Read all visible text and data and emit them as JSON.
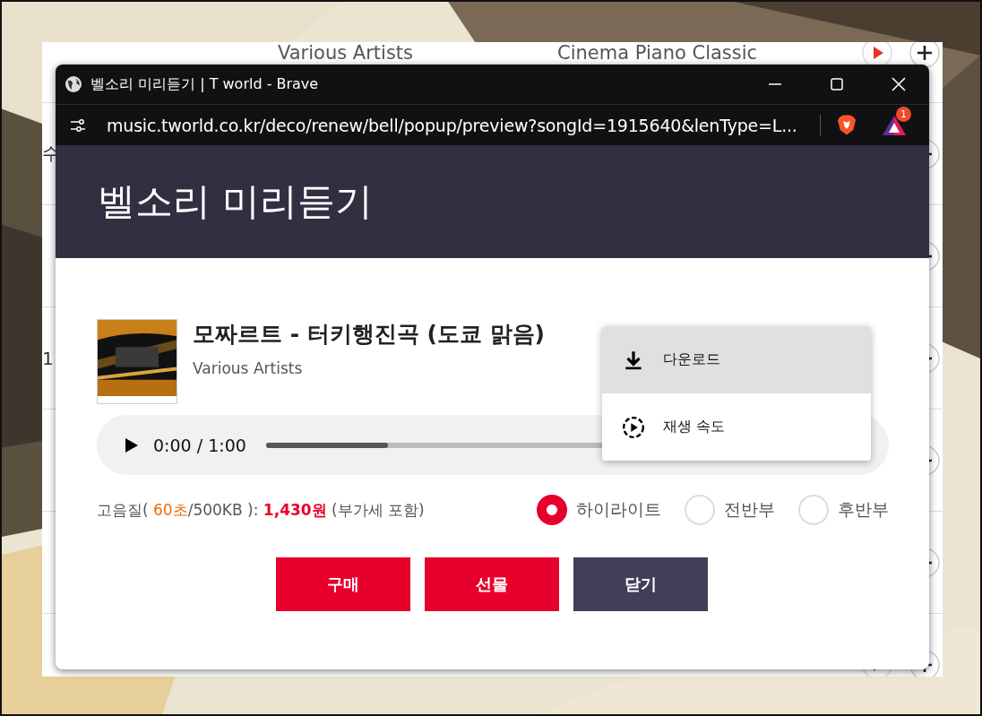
{
  "background_page": {
    "rows": [
      {
        "artist": "Various Artists",
        "album": "Cinema Piano Classic"
      },
      {
        "column_1": "수"
      },
      {},
      {
        "column_1": "1"
      },
      {},
      {},
      {}
    ]
  },
  "window": {
    "title": "벨소리 미리듣기 | T world - Brave",
    "url": "music.tworld.co.kr/deco/renew/bell/popup/preview?songId=1915640&lenType=L...",
    "extension_badge": "1"
  },
  "header": {
    "title": "벨소리 미리듣기"
  },
  "song": {
    "title": "모짜르트 - 터키행진곡 (도쿄 맑음)",
    "artist": "Various Artists"
  },
  "player": {
    "time": "0:00 / 1:00",
    "level": 0.21
  },
  "menu": {
    "items": [
      {
        "label": "다운로드",
        "kind": "download",
        "selected": true
      },
      {
        "label": "재생 속도",
        "kind": "speed",
        "selected": false
      }
    ]
  },
  "price": [
    {
      "text": "고음질( ",
      "kind": "plain"
    },
    {
      "text": "60초",
      "kind": "accent"
    },
    {
      "text": "/500KB ): ",
      "kind": "plain"
    },
    {
      "text": "1,430원",
      "kind": "price"
    },
    {
      "text": " (부가세 포함)",
      "kind": "plain"
    }
  ],
  "options": [
    {
      "label": "하이라이트",
      "selected": true
    },
    {
      "label": "전반부",
      "selected": false
    },
    {
      "label": "후반부",
      "selected": false
    }
  ],
  "buttons": [
    {
      "label": "구매",
      "kind": "primary"
    },
    {
      "label": "선물",
      "kind": "primary"
    },
    {
      "label": "닫기",
      "kind": "dark"
    }
  ]
}
